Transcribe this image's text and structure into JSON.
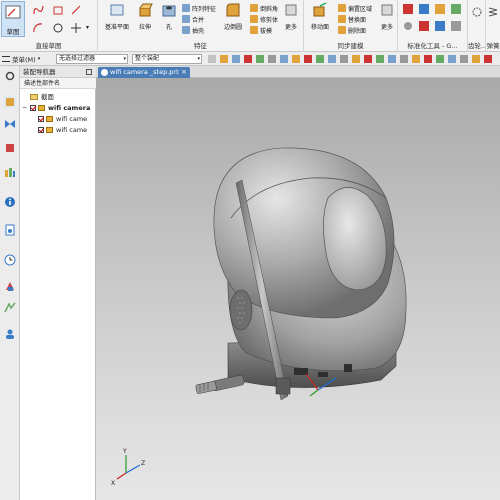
{
  "ribbon": {
    "sketch_label": "草图",
    "group_direct_sketch": "直接草图",
    "group_feature": "特征",
    "group_sync": "同步建模",
    "group_standard": "标准化工具 - G...",
    "group_gear": "齿轮...",
    "group_spring": "弹簧",
    "datum_plane": "基准平面",
    "extrude": "拉伸",
    "hole": "孔",
    "pattern_feature": "阵列特征",
    "unite": "合并",
    "shell": "抽壳",
    "edge_blend": "边倒圆",
    "chamfer": "倒斜角",
    "trim_body": "修剪体",
    "draft": "拔模",
    "more1": "更多",
    "move_face": "移动面",
    "offset_region": "偏置区域",
    "replace_face": "替换面",
    "delete_face": "删除面",
    "more2": "更多"
  },
  "cmdbar": {
    "menu": "菜单(M)",
    "filter": "无选择过滤器",
    "scope": "整个装配"
  },
  "navigator": {
    "title": "装配导航器",
    "column": "描述性部件名",
    "section": "截面",
    "root": "wifi camera",
    "child1": "wifi came",
    "child2": "wifi came"
  },
  "doc": {
    "tab": "wifi camera _step.prt",
    "close": "×"
  },
  "axes": {
    "x": "X",
    "y": "Y",
    "z": "Z"
  },
  "colors": {
    "model_gray": "#9a9a9a",
    "viewport_top": "#a9a9a9",
    "viewport_bottom": "#e6e6e6",
    "tab_active": "#4a7db8"
  }
}
